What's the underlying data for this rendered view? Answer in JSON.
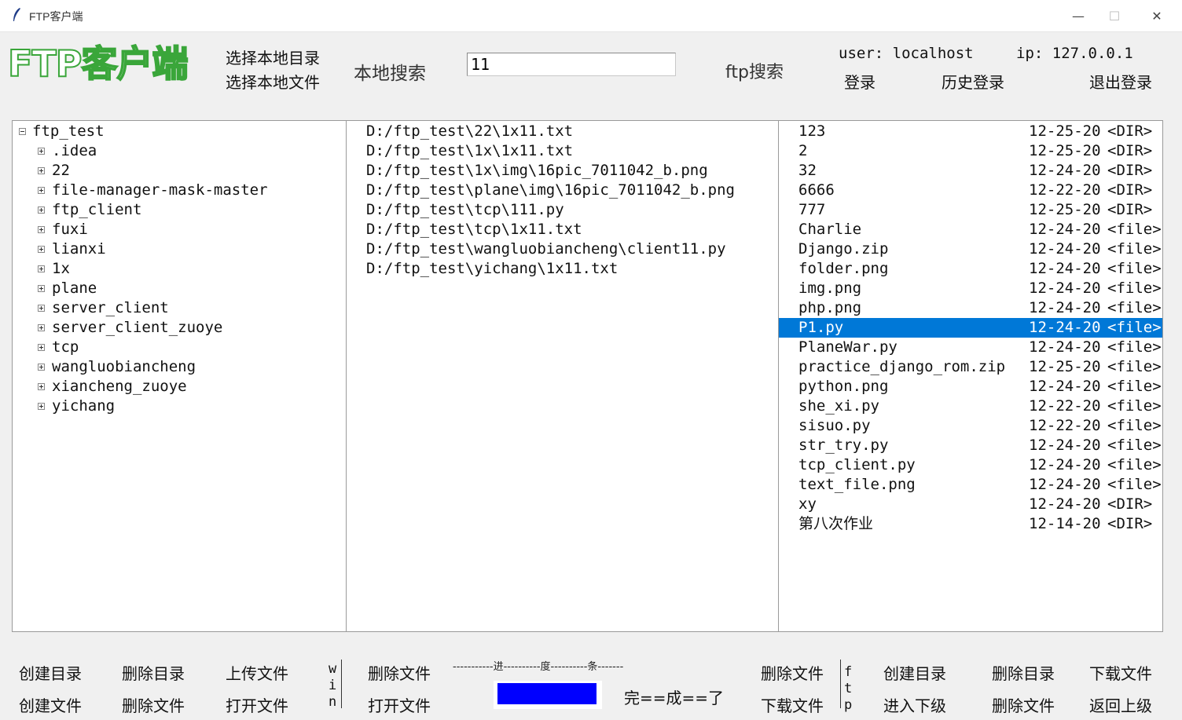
{
  "window": {
    "title": "FTP客户端",
    "controls": [
      "—",
      "☐",
      "✕"
    ]
  },
  "header": {
    "logo": "FTP客户端",
    "select_dir": "选择本地目录",
    "select_file": "选择本地文件",
    "local_search_label": "本地搜索",
    "search_value": "11",
    "ftp_search_label": "ftp搜索",
    "user_label": "user: localhost",
    "ip_label": "ip: 127.0.0.1",
    "login": "登录",
    "history_login": "历史登录",
    "logout": "退出登录"
  },
  "tree": {
    "root": "ftp_test",
    "children": [
      ".idea",
      "22",
      "file-manager-mask-master",
      "ftp_client",
      "fuxi",
      "lianxi",
      "1x",
      "plane",
      "server_client",
      "server_client_zuoye",
      "tcp",
      "wangluobiancheng",
      "xiancheng_zuoye",
      "yichang"
    ]
  },
  "results": [
    "D:/ftp_test\\22\\1x11.txt",
    "D:/ftp_test\\1x\\1x11.txt",
    "D:/ftp_test\\1x\\img\\16pic_7011042_b.png",
    "D:/ftp_test\\plane\\img\\16pic_7011042_b.png",
    "D:/ftp_test\\tcp\\111.py",
    "D:/ftp_test\\tcp\\1x11.txt",
    "D:/ftp_test\\wangluobiancheng\\client11.py",
    "D:/ftp_test\\yichang\\1x11.txt"
  ],
  "ftp_files": [
    {
      "name": "123",
      "date": "12-25-20",
      "type": "<DIR>"
    },
    {
      "name": "2",
      "date": "12-25-20",
      "type": "<DIR>"
    },
    {
      "name": "32",
      "date": "12-24-20",
      "type": "<DIR>"
    },
    {
      "name": "6666",
      "date": "12-22-20",
      "type": "<DIR>"
    },
    {
      "name": "777",
      "date": "12-25-20",
      "type": "<DIR>"
    },
    {
      "name": "Charlie",
      "date": "12-24-20",
      "type": "<file>"
    },
    {
      "name": "Django.zip",
      "date": "12-24-20",
      "type": "<file>"
    },
    {
      "name": "folder.png",
      "date": "12-24-20",
      "type": "<file>"
    },
    {
      "name": "img.png",
      "date": "12-24-20",
      "type": "<file>"
    },
    {
      "name": "php.png",
      "date": "12-24-20",
      "type": "<file>"
    },
    {
      "name": "P1.py",
      "date": "12-24-20",
      "type": "<file>"
    },
    {
      "name": "PlaneWar.py",
      "date": "12-24-20",
      "type": "<file>"
    },
    {
      "name": "practice_django_rom.zip",
      "date": "12-25-20",
      "type": "<file>"
    },
    {
      "name": "python.png",
      "date": "12-24-20",
      "type": "<file>"
    },
    {
      "name": "she_xi.py",
      "date": "12-22-20",
      "type": "<file>"
    },
    {
      "name": "sisuo.py",
      "date": "12-22-20",
      "type": "<file>"
    },
    {
      "name": "str_try.py",
      "date": "12-24-20",
      "type": "<file>"
    },
    {
      "name": "tcp_client.py",
      "date": "12-24-20",
      "type": "<file>"
    },
    {
      "name": "text_file.png",
      "date": "12-24-20",
      "type": "<file>"
    },
    {
      "name": "xy",
      "date": "12-24-20",
      "type": "<DIR>"
    },
    {
      "name": "第八次作业",
      "date": "12-14-20",
      "type": "<DIR>"
    }
  ],
  "selected_ftp_index": 10,
  "footer": {
    "local_create_dir": "创建目录",
    "local_delete_dir": "删除目录",
    "local_upload": "上传文件",
    "local_create_file": "创建文件",
    "local_delete_file": "删除文件",
    "local_open_file": "打开文件",
    "win_label": [
      "w",
      "i",
      "n"
    ],
    "win_delete_file": "删除文件",
    "win_open_file": "打开文件",
    "progress_caption": "-----------进----------度----------条-------",
    "progress_fraction": 1.0,
    "progress_status": "完==成==了",
    "ftp_delete_file": "删除文件",
    "ftp_download_file_left": "下载文件",
    "ftp_label": [
      "f",
      "t",
      "p"
    ],
    "ftp_create_dir": "创建目录",
    "ftp_delete_dir": "删除目录",
    "ftp_download": "下载文件",
    "ftp_enter_sub": "进入下级",
    "ftp_delete_file2": "删除文件",
    "ftp_back_up": "返回上级"
  },
  "colors": {
    "selection": "#0078d7",
    "progress": "#0000ff",
    "logo_outline": "#3aa63a"
  }
}
